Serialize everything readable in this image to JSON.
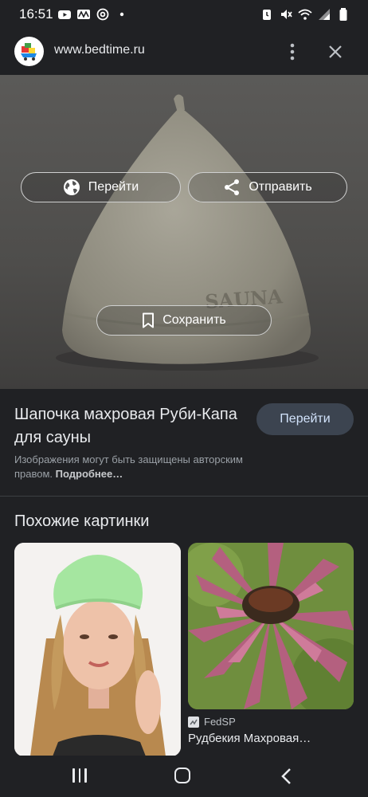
{
  "status_bar": {
    "time": "16:51",
    "left_icons": [
      "youtube-icon",
      "mail-icon",
      "at-icon",
      "dot-icon"
    ],
    "right_icons": [
      "alarm-icon",
      "mute-icon",
      "wifi-icon",
      "signal-icon",
      "battery-icon"
    ]
  },
  "header": {
    "url": "www.bedtime.ru",
    "menu_icon": "more-vert-icon",
    "close_icon": "close-icon"
  },
  "image_overlay": {
    "goto_label": "Перейти",
    "share_label": "Отправить",
    "save_label": "Сохранить",
    "hat_text": "SAUNA"
  },
  "info": {
    "title": "Шапочка махровая Руби-Капа для сауны",
    "visit_label": "Перейти",
    "copyright_text": "Изображения могут быть защищены авторским правом. ",
    "copyright_link": "Подробнее…"
  },
  "similar": {
    "heading": "Похожие картинки",
    "items": [
      {
        "source": "",
        "title": ""
      },
      {
        "source": "FedSP",
        "title": "Рудбекия Махровая…"
      }
    ]
  },
  "colors": {
    "background": "#202124",
    "accent_button": "#3c4450",
    "text_primary": "#e8eaed",
    "text_secondary": "#9aa0a6"
  }
}
